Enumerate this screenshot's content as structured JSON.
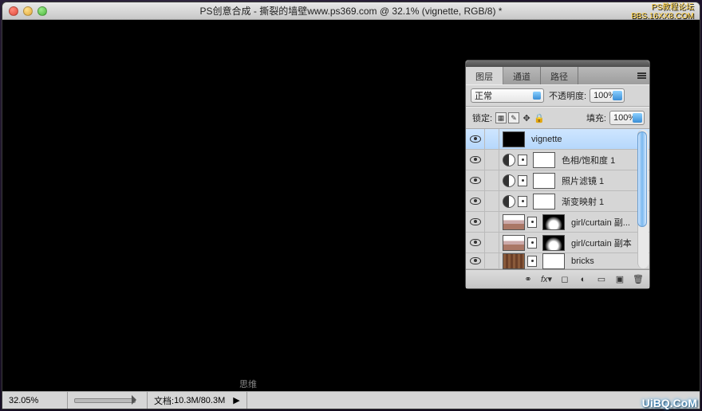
{
  "window": {
    "title": "PS创意合成 - 撕裂的墙壁www.ps369.com @ 32.1% (vignette, RGB/8) *"
  },
  "status": {
    "zoom": "32.05%",
    "doc_label": "文档:",
    "doc_value": "10.3M/80.3M"
  },
  "layers_panel": {
    "tabs": {
      "layers": "图层",
      "channels": "通道",
      "paths": "路径"
    },
    "blend_mode": "正常",
    "opacity_label": "不透明度:",
    "opacity_value": "100%",
    "lock_label": "锁定:",
    "fill_label": "填充:",
    "fill_value": "100%",
    "layers": [
      {
        "name": "vignette"
      },
      {
        "name": "色相/饱和度 1"
      },
      {
        "name": "照片滤镜 1"
      },
      {
        "name": "渐变映射 1"
      },
      {
        "name": "girl/curtain 副..."
      },
      {
        "name": "girl/curtain 副本"
      },
      {
        "name": "bricks"
      }
    ]
  },
  "watermarks": {
    "top_right_1": "PS教程论坛",
    "top_right_2": "BBS.16XX8.COM",
    "bottom_left": "思维",
    "bottom_right": "UiBQ.CoM"
  }
}
